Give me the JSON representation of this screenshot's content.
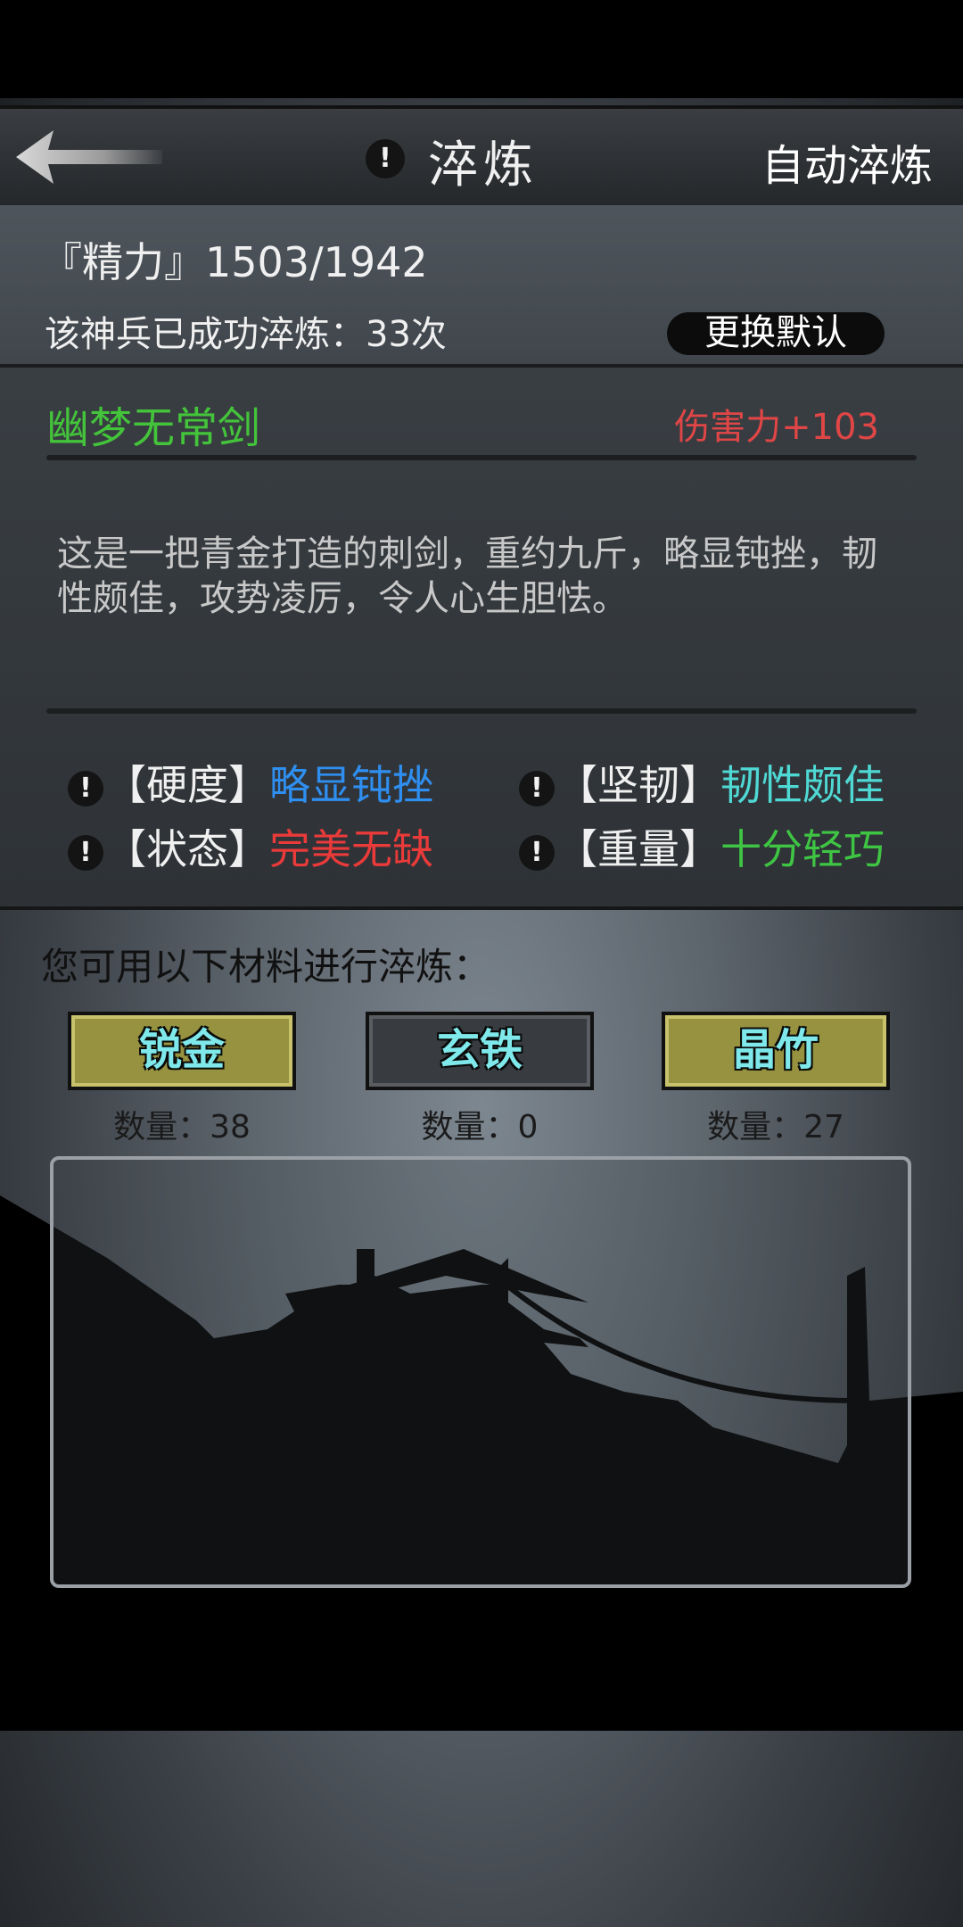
{
  "header": {
    "title": "淬炼",
    "auto_label": "自动淬炼",
    "info_icon": "!"
  },
  "stats": {
    "stamina": "『精力』1503/1942",
    "refine_count": "该神兵已成功淬炼：33次",
    "change_default_label": "更换默认"
  },
  "item": {
    "name": "幽梦无常剑",
    "damage": "伤害力+103",
    "description": "这是一把青金打造的刺剑，重约九斤，略显钝挫，韧性颇佳，攻势凌厉，令人心生胆怯。",
    "attributes": [
      {
        "label": "【硬度】",
        "value": "略显钝挫",
        "color": "#2f8ff0"
      },
      {
        "label": "【坚韧】",
        "value": "韧性颇佳",
        "color": "#4fd9d4"
      },
      {
        "label": "【状态】",
        "value": "完美无缺",
        "color": "#ea3a3a"
      },
      {
        "label": "【重量】",
        "value": "十分轻巧",
        "color": "#3fc544"
      }
    ]
  },
  "materials": {
    "prompt": "您可用以下材料进行淬炼：",
    "items": [
      {
        "name": "锐金",
        "quantity": "数量：38",
        "available": true
      },
      {
        "name": "玄铁",
        "quantity": "数量：0",
        "available": false
      },
      {
        "name": "晶竹",
        "quantity": "数量：27",
        "available": true
      }
    ]
  },
  "icons": {
    "back": "back-arrow-icon",
    "info": "info-icon"
  }
}
